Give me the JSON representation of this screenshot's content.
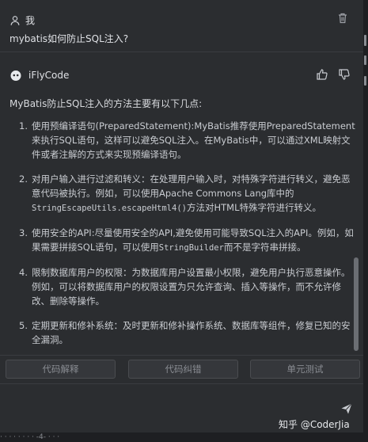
{
  "user": {
    "name": "我",
    "question": "mybatis如何防止SQL注入?"
  },
  "assistant": {
    "name": "iFlyCode",
    "intro": "MyBatis防止SQL注入的方法主要有以下几点:",
    "items": [
      {
        "num": "1.",
        "text": "使用预编译语句(PreparedStatement):MyBatis推荐使用PreparedStatement来执行SQL语句，这样可以避免SQL注入。在MyBatis中，可以通过XML映射文件或者注解的方式来实现预编译语句。"
      },
      {
        "num": "2.",
        "pre": "对用户输入进行过滤和转义：在处理用户输入时，对特殊字符进行转义，避免恶意代码被执行。例如，可以使用Apache Commons Lang库中的",
        "code": "StringEscapeUtils.escapeHtml4()",
        "post": "方法对HTML特殊字符进行转义。"
      },
      {
        "num": "3.",
        "pre": "使用安全的API:尽量使用安全的API,避免使用可能导致SQL注入的API。例如，如果需要拼接SQL语句，可以使用",
        "code": "StringBuilder",
        "post": "而不是字符串拼接。"
      },
      {
        "num": "4.",
        "text": "限制数据库用户的权限：为数据库用户设置最小权限，避免用户执行恶意操作。例如，可以将数据库用户的权限设置为只允许查询、插入等操作，而不允许修改、删除等操作。"
      },
      {
        "num": "5.",
        "text": "定期更新和修补系统：及时更新和修补操作系统、数据库等组件，修复已知的安全漏洞。"
      }
    ]
  },
  "actions": {
    "explain": "代码解释",
    "fix": "代码纠错",
    "test": "单元测试"
  },
  "watermark": "知乎 @CoderJia",
  "bottom_fragment": "· ·  ·  ·  ·  · ·  · -4-  ·  ·  ·"
}
